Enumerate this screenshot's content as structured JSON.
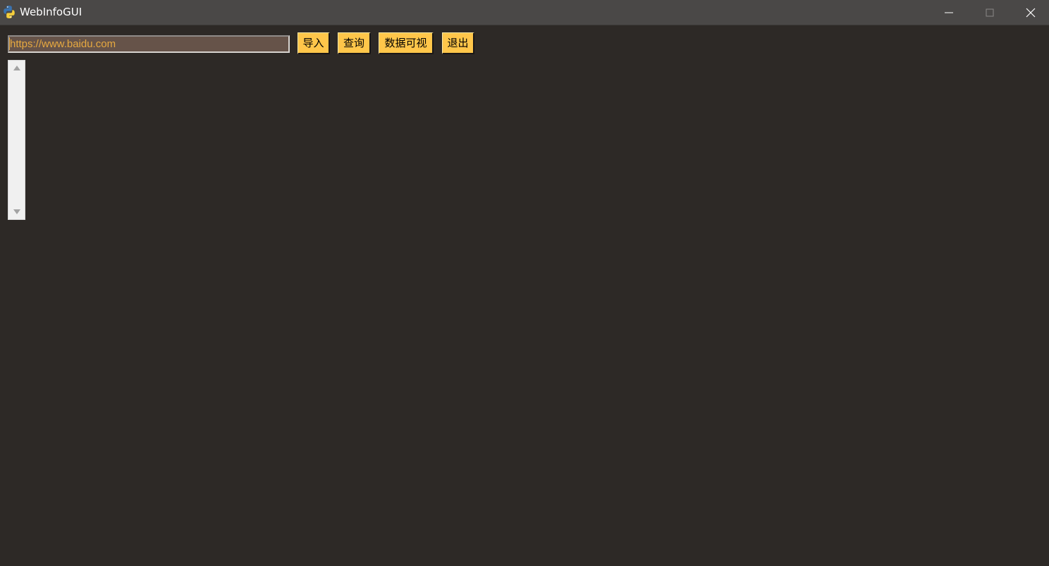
{
  "window": {
    "title": "WebInfoGUI",
    "app_icon": "python-icon",
    "controls": {
      "minimize_icon": "minimize-icon",
      "maximize_icon": "maximize-icon",
      "close_icon": "close-icon"
    }
  },
  "toolbar": {
    "url_value": "https://www.baidu.com",
    "import_label": "导入",
    "query_label": "查询",
    "visualize_label": "数据可视",
    "exit_label": "退出"
  },
  "results": {
    "scrollbar_up_icon": "scroll-up-arrow-icon",
    "scrollbar_down_icon": "scroll-down-arrow-icon"
  },
  "colors": {
    "background": "#2d2926",
    "titlebar": "#4a4847",
    "button": "#ffc64a",
    "input_bg": "#665349",
    "input_text": "#e7a940"
  }
}
